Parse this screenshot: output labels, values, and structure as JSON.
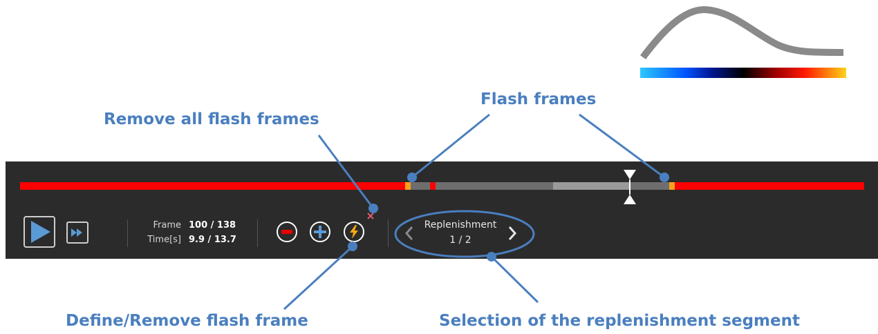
{
  "callouts": {
    "remove_all": "Remove all flash frames",
    "flash_frames": "Flash frames",
    "define_remove": "Define/Remove flash frame",
    "selection": "Selection of the replenishment segment"
  },
  "toolbar": {
    "frame_label": "Frame",
    "frame_value": "100 / 138",
    "time_label": "Time[s]",
    "time_value": "9.9 / 13.7"
  },
  "segment_selector": {
    "title": "Replenishment",
    "page": "1 / 2"
  },
  "icons": {
    "play": "play-icon",
    "fast_forward": "fast-forward-icon",
    "minus": "minus-circle-icon",
    "plus": "plus-circle-icon",
    "flash": "lightning-circle-icon",
    "remove_all": "close-icon",
    "prev": "chevron-left-icon",
    "next": "chevron-right-icon"
  },
  "colors": {
    "accent": "#4a7fbf",
    "timeline_active": "#ff0000",
    "flash_marker": "#f7a11a",
    "toolbar_bg": "#2b2b2b"
  }
}
